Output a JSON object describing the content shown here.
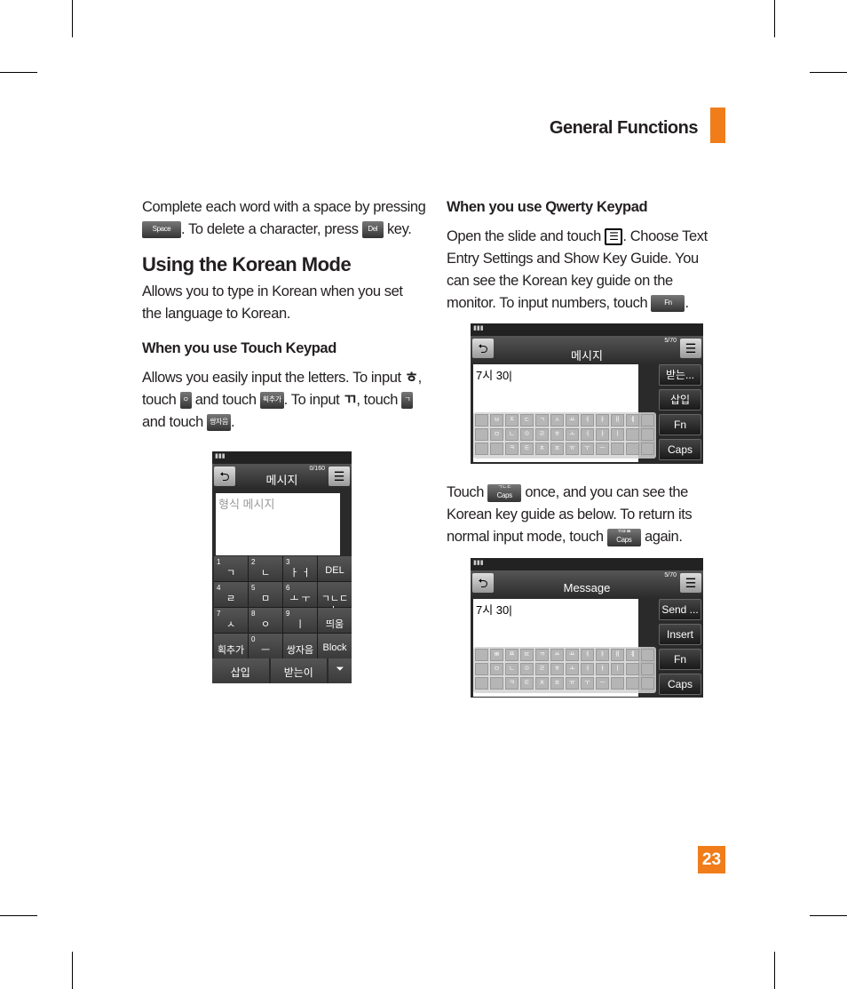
{
  "header": {
    "section": "General Functions",
    "page_number": "23"
  },
  "left": {
    "intro": [
      "Complete each word with a space by pressing",
      ". To delete a character, press",
      "key."
    ],
    "keys": {
      "space": "Space",
      "del": "Del",
      "o": "ㅇ",
      "add_stroke": "획추가",
      "g": "ㄱ",
      "double": "쌍자음"
    },
    "title": "Using the Korean Mode",
    "desc": "Allows you to type in Korean when you set the language to Korean.",
    "touch_heading": "When you use Touch Keypad",
    "touch_text": [
      "Allows you easily input the letters. To input ",
      "ㅎ",
      ", touch",
      " and touch ",
      ". To input ",
      "ㄲ",
      ", touch",
      " and touch ",
      "."
    ]
  },
  "right": {
    "qwerty_heading": "When you use Qwerty Keypad",
    "qwerty_text": [
      "Open the slide and touch ",
      ". Choose Text Entry Settings and Show Key Guide. You can see the Korean key guide on the monitor. To input numbers, touch ",
      "."
    ],
    "fn": "Fn",
    "caps": "Caps",
    "caps_top": "ㄱㄴㄷ",
    "caps_top2": "ㄲㄸㅃ",
    "touch_text": [
      "Touch ",
      " once, and you can see the Korean key guide as below. To return its normal input mode, touch ",
      " again."
    ]
  },
  "phone1": {
    "title": "메시지",
    "counter": "0/160",
    "placeholder": "형식 메시지",
    "keys": [
      {
        "n": "1",
        "l": "ㄱ"
      },
      {
        "n": "2",
        "l": "ㄴ"
      },
      {
        "n": "3",
        "l": "ㅏ ㅓ"
      },
      {
        "n": "",
        "l": "DEL"
      },
      {
        "n": "4",
        "l": "ㄹ"
      },
      {
        "n": "5",
        "l": "ㅁ"
      },
      {
        "n": "6",
        "l": "ㅗ ㅜ"
      },
      {
        "n": "",
        "l": "ㄱㄴㄷ abc"
      },
      {
        "n": "7",
        "l": "ㅅ"
      },
      {
        "n": "8",
        "l": "ㅇ"
      },
      {
        "n": "9",
        "l": "ㅣ"
      },
      {
        "n": "",
        "l": "띄움"
      },
      {
        "n": "",
        "l": "획추가"
      },
      {
        "n": "0",
        "l": "ㅡ"
      },
      {
        "n": "",
        "l": "쌍자음"
      },
      {
        "n": "",
        "l": "Block"
      }
    ],
    "bottom": [
      "삽입",
      "받는이"
    ]
  },
  "phone2": {
    "title": "메시지",
    "counter": "5/70",
    "input": "7시 30",
    "side": [
      "받는...",
      "삽입",
      "Fn",
      "Caps"
    ],
    "rows": [
      [
        "",
        "ㅂ",
        "ㅈ",
        "ㄷ",
        "ㄱ",
        "ㅅ",
        "ㅛ",
        "ㅕ",
        "ㅑ",
        "ㅐ",
        "ㅔ",
        ""
      ],
      [
        "",
        "ㅁ",
        "ㄴ",
        "ㅇ",
        "ㄹ",
        "ㅎ",
        "ㅗ",
        "ㅓ",
        "ㅏ",
        "ㅣ",
        "",
        ""
      ],
      [
        "",
        "",
        "ㅋ",
        "ㅌ",
        "ㅊ",
        "ㅍ",
        "ㅠ",
        "ㅜ",
        "ㅡ",
        "",
        "",
        ""
      ]
    ]
  },
  "phone3": {
    "title": "Message",
    "counter": "5/70",
    "input": "7시 30",
    "side": [
      "Send ...",
      "Insert",
      "Fn",
      "Caps"
    ],
    "rows": [
      [
        "",
        "ㅃ",
        "ㅉ",
        "ㄸ",
        "ㄲ",
        "ㅆ",
        "ㅛ",
        "ㅕ",
        "ㅑ",
        "ㅒ",
        "ㅖ",
        ""
      ],
      [
        "",
        "ㅁ",
        "ㄴ",
        "ㅇ",
        "ㄹ",
        "ㅎ",
        "ㅗ",
        "ㅓ",
        "ㅏ",
        "ㅣ",
        "",
        ""
      ],
      [
        "",
        "",
        "ㅋ",
        "ㅌ",
        "ㅊ",
        "ㅍ",
        "ㅠ",
        "ㅜ",
        "ㅡ",
        "",
        "",
        ""
      ]
    ]
  }
}
